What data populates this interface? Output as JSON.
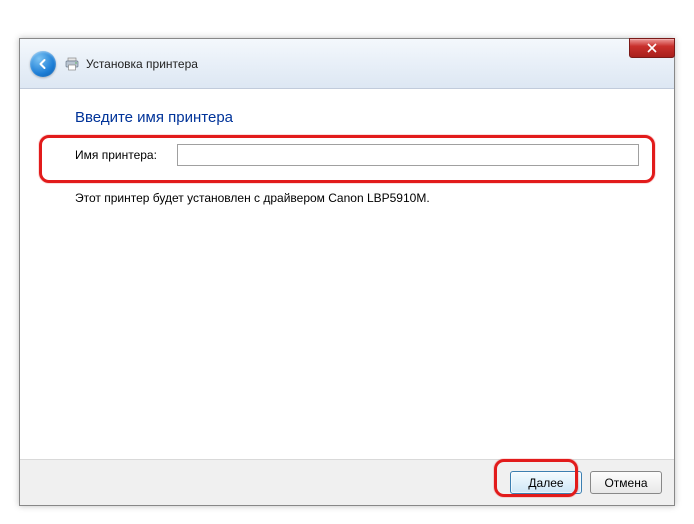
{
  "titlebar": {
    "title": "Установка принтера"
  },
  "content": {
    "heading": "Введите имя принтера",
    "name_label": "Имя принтера:",
    "name_value": "",
    "info_text": "Этот принтер будет установлен с драйвером Canon LBP5910M."
  },
  "footer": {
    "next_label": "Далее",
    "cancel_label": "Отмена"
  }
}
